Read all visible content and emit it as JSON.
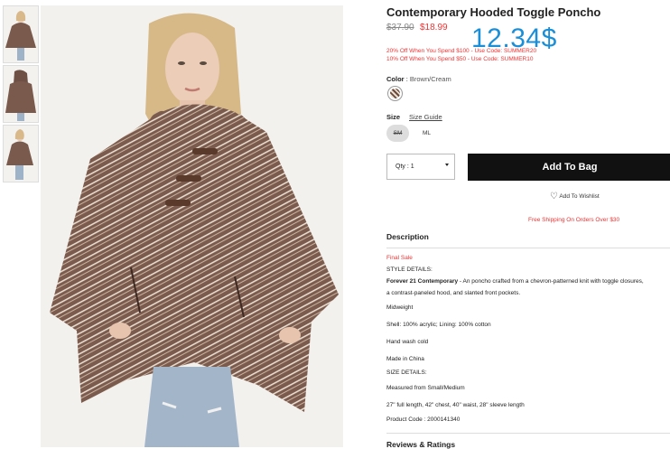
{
  "product": {
    "title": "Contemporary Hooded Toggle Poncho",
    "old_price": "$37.90",
    "sale_price": "$18.99",
    "overlay_price": "12.34$",
    "promos": [
      "20% Off When You Spend $100 - Use Code: SUMMER20",
      "10% Off When You Spend $50 - Use Code: SUMMER10"
    ]
  },
  "color": {
    "label": "Color",
    "value": "Brown/Cream",
    "swatch_icon": "chevron-swatch"
  },
  "size": {
    "label": "Size",
    "guide_link": "Size Guide",
    "options": [
      "SM",
      "ML"
    ],
    "selected": "SM"
  },
  "purchase": {
    "qty_label": "Qty : 1",
    "add_button": "Add To Bag",
    "wishlist": "Add To Wishlist"
  },
  "shipping_note": "Free Shipping On Orders Over $30",
  "description": {
    "heading": "Description",
    "final_sale": "Final Sale",
    "style_heading": "STYLE DETAILS:",
    "brand": "Forever 21 Contemporary",
    "summary_1": " - An poncho crafted from a chevron-patterned knit with toggle closures,",
    "summary_2": "a contrast-paneled hood, and slanted front pockets.",
    "weight": "Midweight",
    "fabric": "Shell: 100% acrylic; Lining: 100% cotton",
    "care": "Hand wash cold",
    "origin": "Made in China",
    "size_heading": "SIZE DETAILS:",
    "measured": "Measured from Small/Medium",
    "measurements": "27\" full length, 42\" chest, 40\" waist, 28\" sleeve length",
    "product_code": "Product Code : 2000141340"
  },
  "reviews_heading": "Reviews & Ratings",
  "colors": {
    "accent_red": "#e33333",
    "overlay_blue": "#1a8fd8",
    "button_black": "#111111"
  }
}
